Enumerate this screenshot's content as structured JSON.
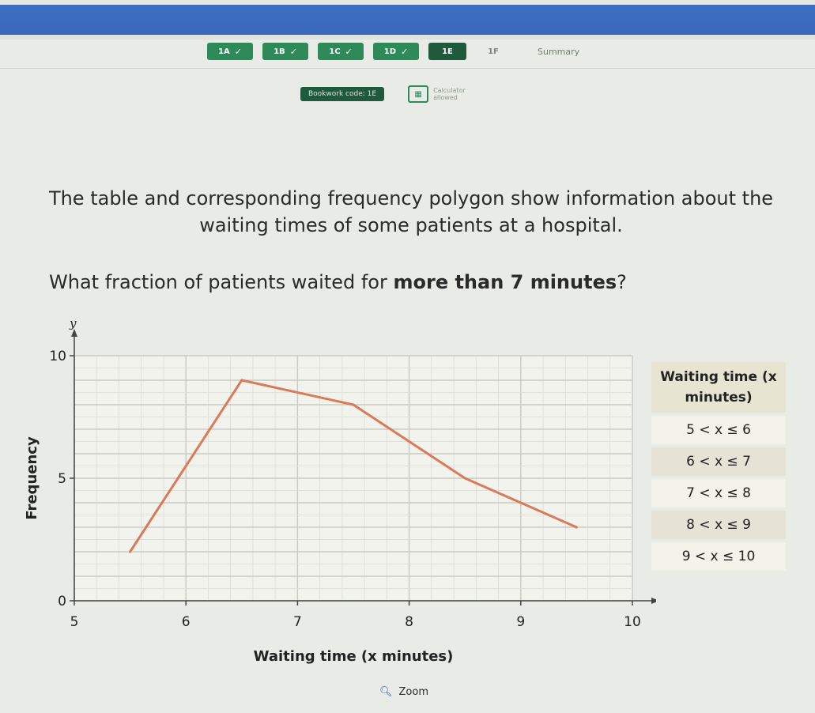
{
  "nav": {
    "tabs": [
      {
        "label": "1A",
        "done": true
      },
      {
        "label": "1B",
        "done": true
      },
      {
        "label": "1C",
        "done": true
      },
      {
        "label": "1D",
        "done": true
      },
      {
        "label": "1E",
        "done": false,
        "current": true
      },
      {
        "label": "1F",
        "done": false
      }
    ],
    "summary": "Summary",
    "check_glyph": "✓"
  },
  "bookwork": {
    "code": "Bookwork code: 1E",
    "calculator": "Calculator allowed"
  },
  "question": {
    "text": "The table and corresponding frequency polygon show information about the waiting times of some patients at a hospital.",
    "prompt_pre": "What fraction of patients waited for ",
    "prompt_bold": "more than 7 minutes",
    "prompt_post": "?"
  },
  "table": {
    "header": "Waiting time (x minutes)",
    "rows": [
      "5 < x ≤ 6",
      "6 < x ≤ 7",
      "7 < x ≤ 8",
      "8 < x ≤ 9",
      "9 < x ≤ 10"
    ]
  },
  "chart_data": {
    "type": "line",
    "x": [
      5.5,
      6.5,
      7.5,
      8.5,
      9.5
    ],
    "y": [
      2,
      9,
      8,
      5,
      3
    ],
    "xlabel": "Waiting time (x minutes)",
    "ylabel": "Frequency",
    "x_axis_symbol": "x",
    "y_axis_symbol": "y",
    "xlim": [
      5,
      10
    ],
    "ylim": [
      0,
      10
    ],
    "x_ticks": [
      5,
      6,
      7,
      8,
      9,
      10
    ],
    "y_ticks": [
      0,
      5,
      10
    ],
    "grid": true,
    "line_color": "#d97b5a"
  },
  "zoom": {
    "label": "Zoom"
  }
}
